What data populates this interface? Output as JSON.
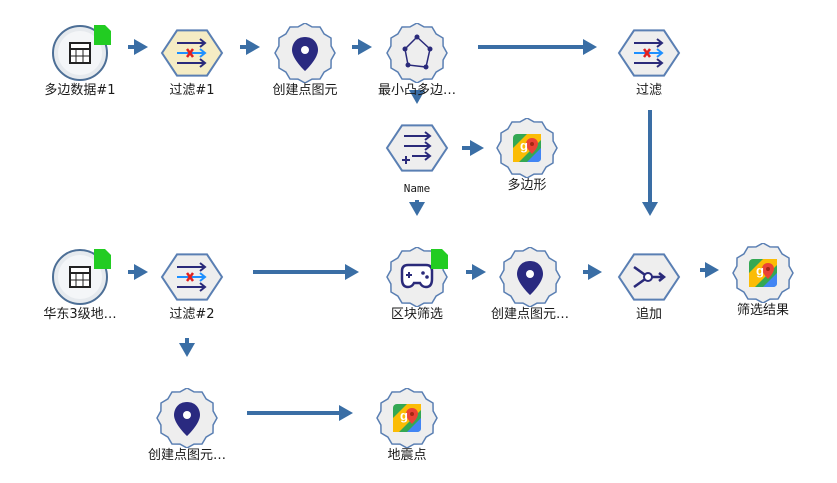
{
  "colors": {
    "edge": "#3a6ea5",
    "hex_fill": "#eeeeee",
    "hex_stroke": "#5a7fb3",
    "hex_fill_filter": "#f5ecc4",
    "doc_badge": "#22cc22",
    "node_icon": "#2a2a7a"
  },
  "nodes": [
    {
      "id": "n1",
      "label": "多边数据#1",
      "icon": "table-icon",
      "shape": "circle",
      "badge": true
    },
    {
      "id": "n2",
      "label": "过滤#1",
      "icon": "filter-icon",
      "shape": "hex",
      "highlight": true
    },
    {
      "id": "n3",
      "label": "创建点图元",
      "icon": "pin-icon",
      "shape": "gear"
    },
    {
      "id": "n4",
      "label": "最小凸多边…",
      "icon": "polygon-icon",
      "shape": "gear"
    },
    {
      "id": "n5",
      "label": "过滤",
      "icon": "filter-icon",
      "shape": "hex"
    },
    {
      "id": "n6",
      "label": "Name",
      "icon": "add-field-icon",
      "shape": "hex",
      "mono": true
    },
    {
      "id": "n7",
      "label": "多边形",
      "icon": "map-icon",
      "shape": "gear"
    },
    {
      "id": "n8",
      "label": "华东3级地…",
      "icon": "table-icon",
      "shape": "circle",
      "badge": true
    },
    {
      "id": "n9",
      "label": "过滤#2",
      "icon": "filter-icon",
      "shape": "hex"
    },
    {
      "id": "n10",
      "label": "区块筛选",
      "icon": "gamepad-icon",
      "shape": "gear",
      "badge": true
    },
    {
      "id": "n11",
      "label": "创建点图元…",
      "icon": "pin-icon",
      "shape": "gear"
    },
    {
      "id": "n12",
      "label": "追加",
      "icon": "append-icon",
      "shape": "hex"
    },
    {
      "id": "n13",
      "label": "筛选结果",
      "icon": "map-icon",
      "shape": "gear"
    },
    {
      "id": "n14",
      "label": "创建点图元…",
      "icon": "pin-icon",
      "shape": "gear"
    },
    {
      "id": "n15",
      "label": "地震点",
      "icon": "map-icon",
      "shape": "gear"
    }
  ],
  "edges": [
    [
      "n1",
      "n2"
    ],
    [
      "n2",
      "n3"
    ],
    [
      "n3",
      "n4"
    ],
    [
      "n4",
      "n5"
    ],
    [
      "n4",
      "n6"
    ],
    [
      "n6",
      "n7"
    ],
    [
      "n6",
      "n10"
    ],
    [
      "n5",
      "n12"
    ],
    [
      "n8",
      "n9"
    ],
    [
      "n9",
      "n10"
    ],
    [
      "n9",
      "n14"
    ],
    [
      "n10",
      "n11"
    ],
    [
      "n11",
      "n12"
    ],
    [
      "n12",
      "n13"
    ],
    [
      "n14",
      "n15"
    ]
  ]
}
